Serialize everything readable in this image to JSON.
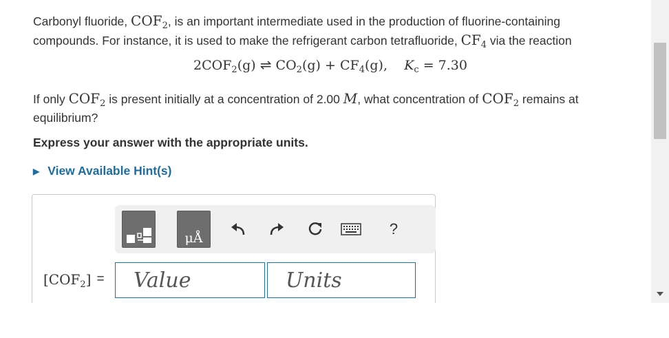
{
  "question": {
    "intro_line1_a": "Carbonyl fluoride, ",
    "intro_line1_b": ", is an important intermediate used in the production of fluorine-containing",
    "intro_line2_a": "compounds. For instance, it is used to make the refrigerant carbon tetrafluoride, ",
    "intro_line2_b": " via the reaction",
    "formula_cof": "COF",
    "formula_cf": "CF",
    "sub2": "2",
    "sub4": "4",
    "equation": {
      "reactant_coeff": "2COF",
      "gas": "(g)",
      "product1": "CO",
      "plus": "+",
      "product2": "CF",
      "k_symbol": "K",
      "k_sub": "c",
      "k_value": "= 7.30"
    },
    "prompt_a": "If only ",
    "prompt_b": " is present initially at a concentration of 2.00 ",
    "prompt_unit": "M",
    "prompt_c": ", what concentration of ",
    "prompt_d": " remains at",
    "prompt_line2": "equilibrium?",
    "instruction": "Express your answer with the appropriate units."
  },
  "hint": {
    "label": "View Available Hint(s)",
    "icon": "triangle-right-icon"
  },
  "answer": {
    "label_open": "[COF",
    "label_sub": "2",
    "label_close": "]",
    "equals": "=",
    "value_placeholder": "Value",
    "units_placeholder": "Units"
  },
  "toolbar": {
    "buttons": [
      "templates-icon",
      "units-icon",
      "undo-icon",
      "redo-icon",
      "reset-icon",
      "keyboard-icon",
      "help-icon"
    ],
    "units_label": "μÅ",
    "help_label": "?"
  },
  "colors": {
    "link": "#1f6c9e",
    "input_border": "#1f6c9e",
    "toolbar_bg": "#f0f0f0",
    "button_bg": "#6e6e6e"
  }
}
